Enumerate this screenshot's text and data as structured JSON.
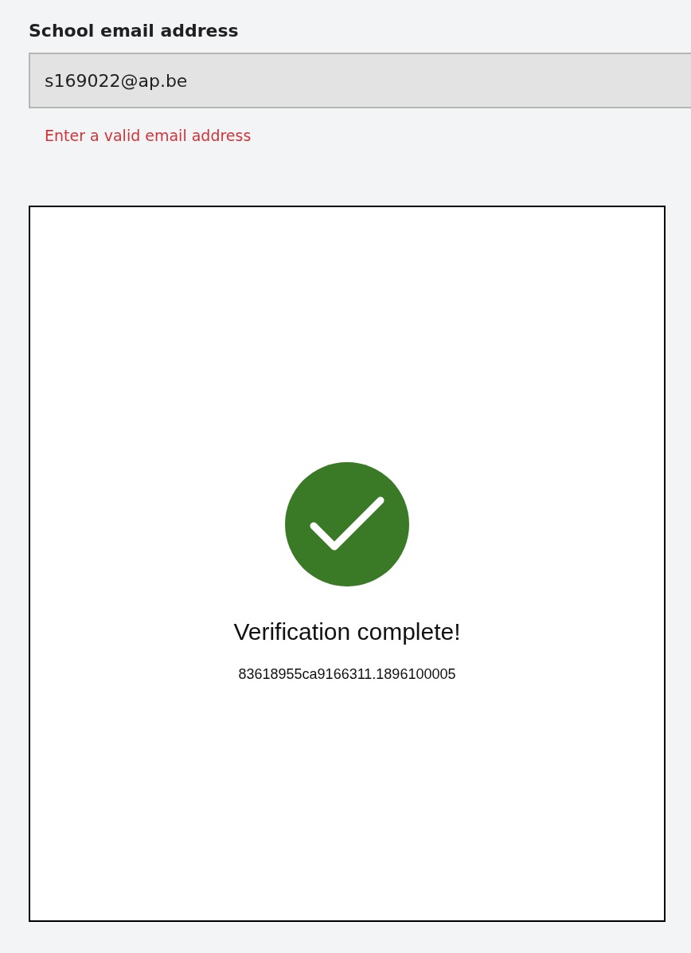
{
  "email_field": {
    "label": "School email address",
    "value": "s169022@ap.be",
    "error": "Enter a valid email address"
  },
  "verification": {
    "verified": true,
    "message": "Verification complete!",
    "code": "83618955ca9166311.1896100005"
  }
}
